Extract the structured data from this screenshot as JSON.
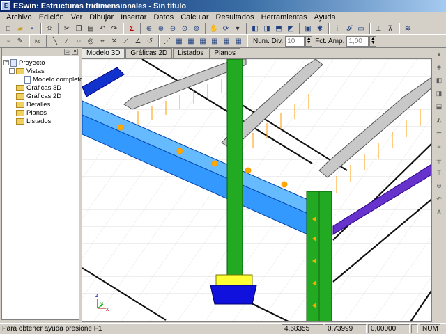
{
  "window": {
    "title": "ESwin: Estructuras tridimensionales - Sin título",
    "app_icon": "eswin-logo-icon"
  },
  "menu": [
    "Archivo",
    "Edición",
    "Ver",
    "Dibujar",
    "Insertar",
    "Datos",
    "Calcular",
    "Resultados",
    "Herramientas",
    "Ayuda"
  ],
  "toolbar2": {
    "num_div_label": "Num. Div.",
    "num_div_value": "10",
    "fct_amp_label": "Fct. Amp.",
    "fct_amp_value": "1,00"
  },
  "tree": {
    "root": "Proyecto",
    "vistas": "Vistas",
    "modelo_completo": "Modelo completo",
    "graficas_3d": "Gráficas 3D",
    "graficas_2d": "Gráficas 2D",
    "detalles": "Detalles",
    "planos": "Planos",
    "listados": "Listados"
  },
  "tabs": [
    "Modelo 3D",
    "Gráficas 2D",
    "Listados",
    "Planos"
  ],
  "active_tab": "Modelo 3D",
  "status": {
    "message": "Para obtener ayuda presione F1",
    "x": "4,68355",
    "y": "0,73999",
    "z": "0,00000",
    "num": "NUM"
  },
  "colors": {
    "beam": "#3399ff",
    "column": "#22aa22",
    "purlin": "#c0c0c0",
    "load": "#ffaa00",
    "base": "#ffff33",
    "footing": "#1111dd",
    "brace": "#6633cc"
  }
}
